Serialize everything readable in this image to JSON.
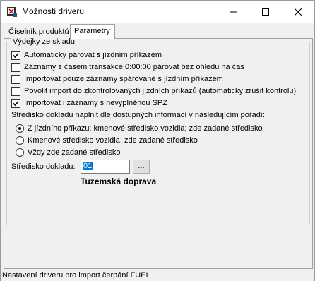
{
  "window": {
    "title": "Možnosti driveru",
    "icon": "app-icon"
  },
  "tabs": [
    {
      "label": "Číselník produktů",
      "active": false
    },
    {
      "label": "Parametry",
      "active": true
    }
  ],
  "group": {
    "legend": "Výdejky ze skladu",
    "checkboxes": [
      {
        "label": "Automaticky párovat s jízdním příkazem",
        "checked": true
      },
      {
        "label": "Záznamy s časem transakce 0:00:00 párovat bez ohledu na čas",
        "checked": false
      },
      {
        "label": "Importovat pouze záznamy spárované s jízdním příkazem",
        "checked": false
      },
      {
        "label": "Povolit import do zkontrolovaných jízdních příkazů (automaticky zrušit kontrolu)",
        "checked": false
      },
      {
        "label": "Importovat i záznamy s nevyplněnou SPZ",
        "checked": true
      }
    ],
    "center_rule_label": "Středisko dokladu naplnit dle dostupných informací v následujícím pořadí:",
    "radios": [
      {
        "label": "Z jízdního příkazu; kmenové středisko vozidla; zde zadané středisko",
        "selected": true
      },
      {
        "label": "Kmenové středisko vozidla; zde zadané středisko",
        "selected": false
      },
      {
        "label": "Vždy zde zadané středisko",
        "selected": false
      }
    ],
    "center_field": {
      "label": "Středisko dokladu:",
      "value": "01",
      "browse_label": "...",
      "resolved_name": "Tuzemská doprava"
    }
  },
  "statusbar": {
    "text": "Nastavení driveru pro import čerpání FUEL"
  },
  "colors": {
    "selection": "#0078d7",
    "window_bg": "#f0f0f0"
  }
}
